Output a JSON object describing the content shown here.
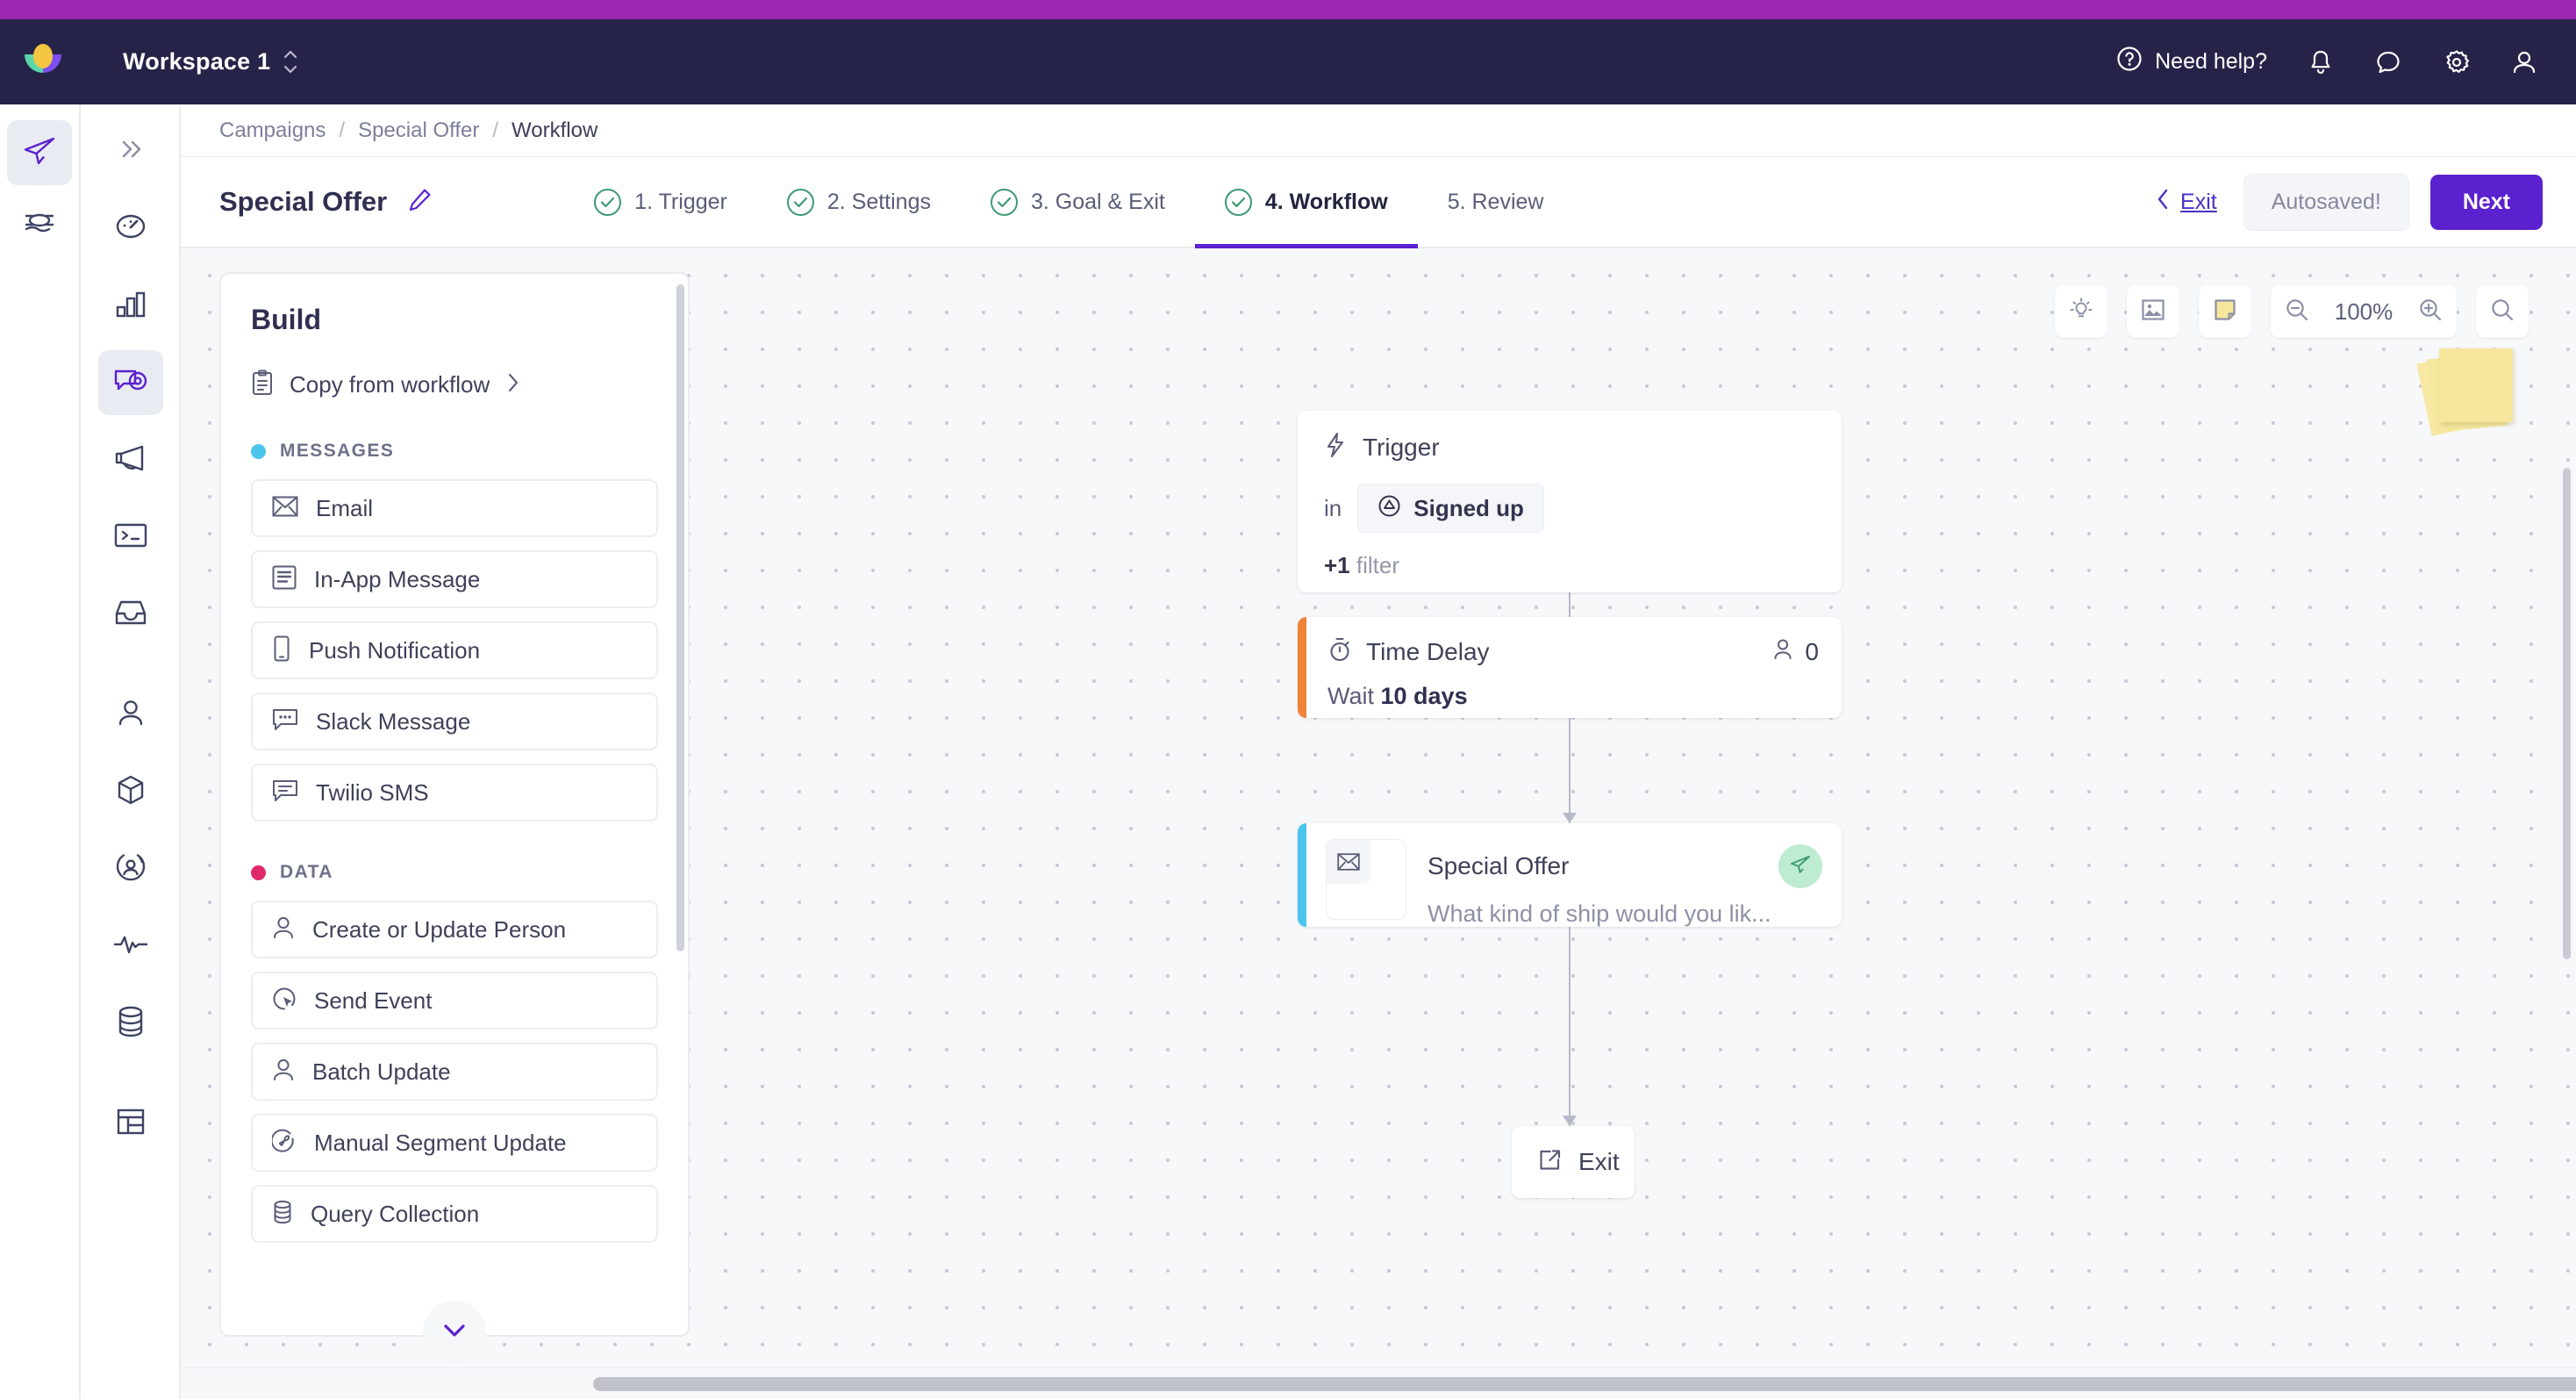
{
  "topbar": {
    "workspace": "Workspace 1",
    "need_help": "Need help?",
    "icons": [
      "help-circle-icon",
      "bell-icon",
      "chat-icon",
      "gear-icon",
      "user-icon"
    ],
    "brand_colors": {
      "strip": "#9b27b0",
      "bar": "#262349",
      "logo_yellow": "#f4c542",
      "logo_teal": "#5bd6a8",
      "logo_purple": "#7a4ef0"
    }
  },
  "rail_primary": {
    "items": [
      {
        "name": "campaigns",
        "icon": "paper-plane-icon",
        "active": true
      },
      {
        "name": "layers",
        "icon": "layers-icon",
        "active": false
      }
    ]
  },
  "rail_secondary": {
    "items": [
      {
        "name": "expand",
        "icon": "chevrons-right-icon",
        "active": false
      },
      {
        "name": "dashboard",
        "icon": "speedometer-icon",
        "active": false
      },
      {
        "name": "analytics",
        "icon": "bar-chart-icon",
        "active": false
      },
      {
        "name": "campaigns",
        "icon": "campaign-eye-icon",
        "active": true
      },
      {
        "name": "broadcasts",
        "icon": "megaphone-icon",
        "active": false
      },
      {
        "name": "api",
        "icon": "terminal-icon",
        "active": false
      },
      {
        "name": "inbox",
        "icon": "inbox-icon",
        "active": false
      },
      {
        "name": "people",
        "icon": "person-icon",
        "active": false
      },
      {
        "name": "objects",
        "icon": "cube-icon",
        "active": false
      },
      {
        "name": "segments",
        "icon": "person-circle-icon",
        "active": false
      },
      {
        "name": "activity",
        "icon": "pulse-icon",
        "active": false
      },
      {
        "name": "data",
        "icon": "database-icon",
        "active": false
      },
      {
        "name": "collections",
        "icon": "table-icon",
        "active": false
      }
    ]
  },
  "breadcrumb": {
    "items": [
      "Campaigns",
      "Special Offer",
      "Workflow"
    ],
    "separator": "/"
  },
  "header": {
    "campaign_name": "Special Offer",
    "edit_icon": "pencil-icon",
    "steps": [
      {
        "label": "1. Trigger",
        "complete": true,
        "active": false
      },
      {
        "label": "2. Settings",
        "complete": true,
        "active": false
      },
      {
        "label": "3. Goal & Exit",
        "complete": true,
        "active": false
      },
      {
        "label": "4. Workflow",
        "complete": true,
        "active": true
      },
      {
        "label": "5. Review",
        "complete": false,
        "active": false
      }
    ],
    "exit_label": "Exit",
    "autosaved_label": "Autosaved!",
    "next_label": "Next",
    "accent_color": "#5b21cf",
    "complete_color": "#3f9a74"
  },
  "build_panel": {
    "title": "Build",
    "copy_from_workflow": "Copy from workflow",
    "sections": [
      {
        "name": "MESSAGES",
        "dot_color": "#4bc5ec",
        "blocks": [
          {
            "label": "Email",
            "icon": "envelope-icon"
          },
          {
            "label": "In-App Message",
            "icon": "in-app-icon"
          },
          {
            "label": "Push Notification",
            "icon": "mobile-icon"
          },
          {
            "label": "Slack Message",
            "icon": "slack-bubble-icon"
          },
          {
            "label": "Twilio SMS",
            "icon": "sms-bubble-icon"
          }
        ]
      },
      {
        "name": "DATA",
        "dot_color": "#e0286d",
        "blocks": [
          {
            "label": "Create or Update Person",
            "icon": "person-icon"
          },
          {
            "label": "Send Event",
            "icon": "send-event-icon"
          },
          {
            "label": "Batch Update",
            "icon": "person-icon"
          },
          {
            "label": "Manual Segment Update",
            "icon": "wrench-circle-icon"
          },
          {
            "label": "Query Collection",
            "icon": "database-icon"
          }
        ]
      }
    ],
    "scroll_more_icon": "chevron-down-icon"
  },
  "canvas": {
    "toolbar": {
      "buttons": [
        {
          "name": "tips",
          "icon": "lightbulb-icon"
        },
        {
          "name": "image",
          "icon": "image-icon"
        },
        {
          "name": "sticky-note",
          "icon": "sticky-note-icon"
        }
      ],
      "zoom_out_icon": "zoom-out-icon",
      "zoom_level": "100%",
      "zoom_in_icon": "zoom-in-icon",
      "search_icon": "search-icon"
    },
    "sticky_note": {
      "name": "sticky-note-stack",
      "color": "#f6e79d"
    },
    "nodes": [
      {
        "type": "trigger",
        "title": "Trigger",
        "icon": "lightning-icon",
        "preposition": "in",
        "chip_label": "Signed up",
        "chip_icon": "segment-icon",
        "filter_count": "+1",
        "filter_label": "filter"
      },
      {
        "type": "delay",
        "title": "Time Delay",
        "icon": "stopwatch-icon",
        "count_icon": "person-icon",
        "count": "0",
        "detail_prefix": "Wait",
        "detail_value": "10 days",
        "accent": "#ef8337"
      },
      {
        "type": "email",
        "title": "Special Offer",
        "thumb_icon": "envelope-icon",
        "preview": "What kind of ship would you lik...",
        "status_icon": "paper-plane-icon",
        "status_color": "#bdecd2",
        "accent": "#4bc5ec"
      },
      {
        "type": "exit",
        "title": "Exit",
        "icon": "external-link-icon"
      }
    ]
  }
}
